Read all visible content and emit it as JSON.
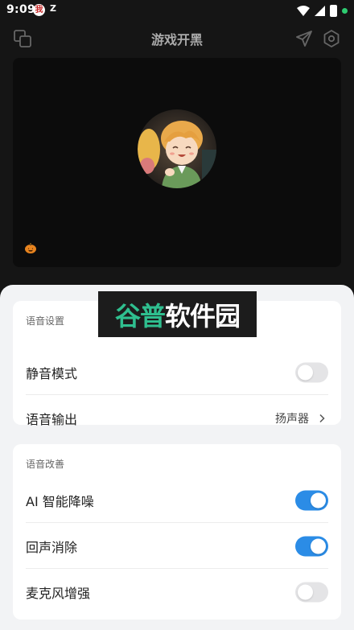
{
  "status_bar": {
    "time": "9:09",
    "notif_badge": "我",
    "notif_letter": "Z",
    "battery_dot_color": "#2ecc71"
  },
  "header": {
    "title": "游戏开黑",
    "icons": [
      "multi-window-icon",
      "send-icon",
      "settings-icon"
    ]
  },
  "preview": {
    "avatar": "avatar-image",
    "corner_icon": "pumpkin-icon"
  },
  "voice_settings": {
    "section_label": "语音设置",
    "rows": [
      {
        "label": "静音模式",
        "type": "toggle",
        "on": false
      },
      {
        "label": "语音输出",
        "type": "select",
        "value": "扬声器"
      }
    ]
  },
  "voice_improve": {
    "section_label": "语音改善",
    "rows": [
      {
        "label": "AI 智能降噪",
        "type": "toggle",
        "on": true
      },
      {
        "label": "回声消除",
        "type": "toggle",
        "on": true
      },
      {
        "label": "麦克风增强",
        "type": "toggle",
        "on": false
      }
    ]
  },
  "watermark": {
    "part1": "谷普",
    "part2": "软件园"
  },
  "colors": {
    "accent": "#2b8ce6",
    "sheet_bg": "#f2f3f5",
    "app_bg": "#151515"
  }
}
